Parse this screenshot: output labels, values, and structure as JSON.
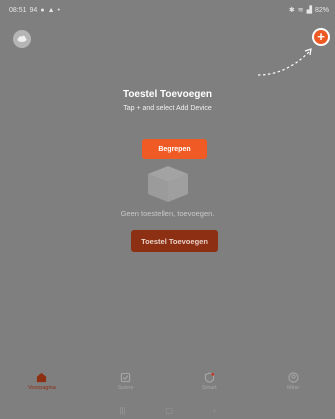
{
  "status_bar": {
    "time": "08:51",
    "indicators": "94",
    "battery": "82%"
  },
  "coach": {
    "title": "Toestel Toevoegen",
    "subtitle": "Tap + and select Add Device",
    "confirm_label": "Begrepen"
  },
  "home": {
    "empty_text": "Geen toestellen, toevoegen.",
    "add_device_label": "Toestel Toevoegen"
  },
  "tabs": [
    {
      "label": "Voorpagina",
      "icon": "home-icon",
      "active": true
    },
    {
      "label": "Scène",
      "icon": "scene-icon",
      "active": false
    },
    {
      "label": "Smart",
      "icon": "smart-icon",
      "active": false
    },
    {
      "label": "Mine",
      "icon": "profile-icon",
      "active": false
    }
  ],
  "colors": {
    "accent": "#f05a24",
    "accent_dim": "#8c2f12"
  }
}
